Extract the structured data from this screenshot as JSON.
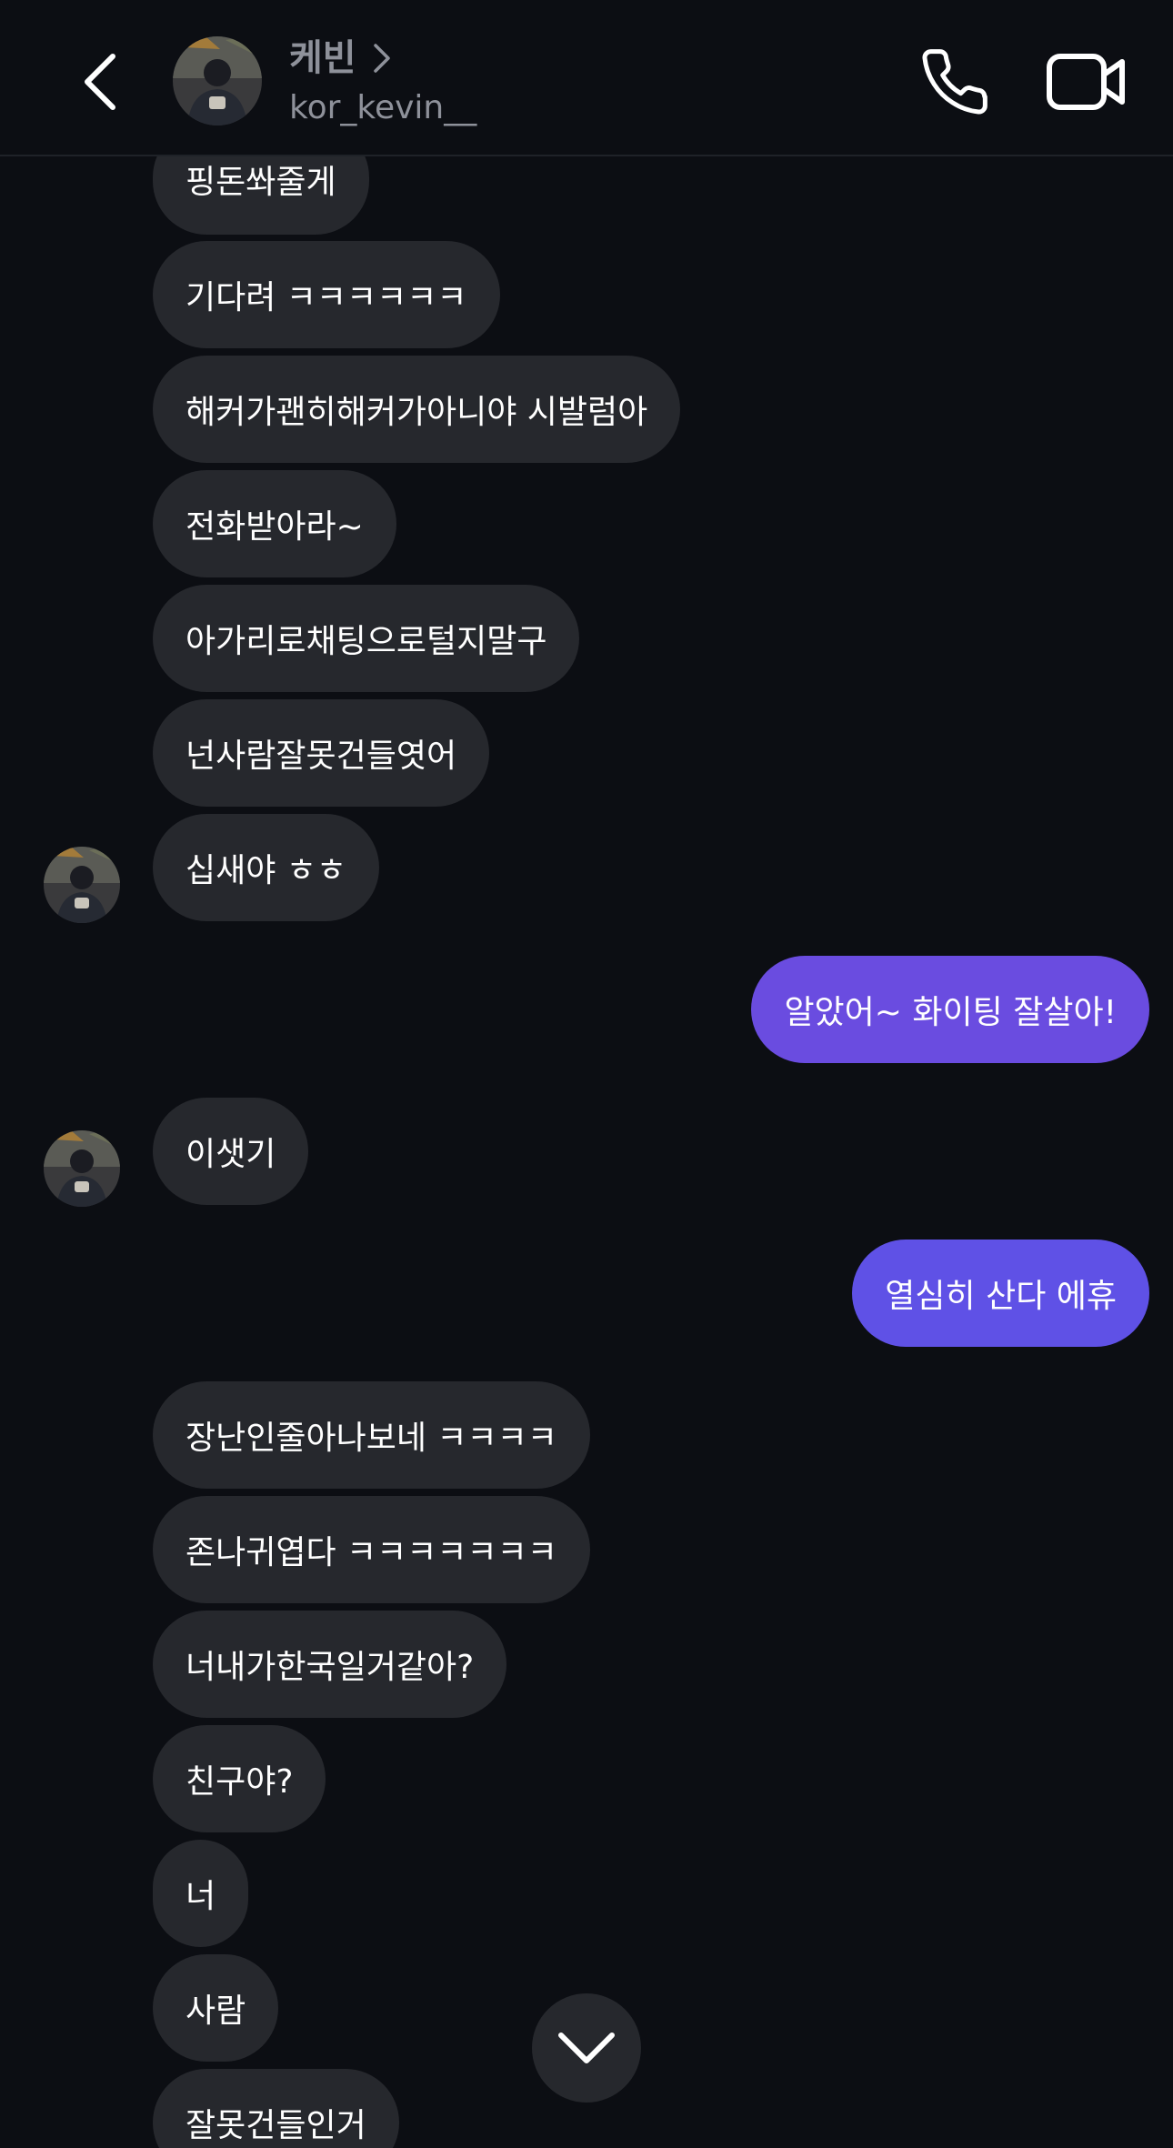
{
  "header": {
    "contact_name": "케빈",
    "username": "kor_kevin__",
    "icons": {
      "back": "chevron-left-icon",
      "name_link": "chevron-right-icon",
      "call": "phone-icon",
      "video": "video-camera-icon"
    }
  },
  "messages": [
    {
      "from": "them",
      "text": "핑돈쏴줄게"
    },
    {
      "from": "them",
      "text": "기다려 ㅋㅋㅋㅋㅋㅋ"
    },
    {
      "from": "them",
      "text": "해커가괜히해커가아니야 시발럼아"
    },
    {
      "from": "them",
      "text": "전화받아라~"
    },
    {
      "from": "them",
      "text": "아가리로채팅으로털지말구"
    },
    {
      "from": "them",
      "text": "넌사람잘못건들엿어"
    },
    {
      "from": "them",
      "text": "십새야 ㅎㅎ"
    },
    {
      "from": "me",
      "text": "알았어~ 화이팅 잘살아!"
    },
    {
      "from": "them",
      "text": "이샛기"
    },
    {
      "from": "me",
      "text": "열심히 산다 에휴"
    },
    {
      "from": "them",
      "text": "장난인줄아나보네 ㅋㅋㅋㅋ"
    },
    {
      "from": "them",
      "text": "존나귀엽다 ㅋㅋㅋㅋㅋㅋㅋ"
    },
    {
      "from": "them",
      "text": "너내가한국일거같아?"
    },
    {
      "from": "them",
      "text": "친구야?"
    },
    {
      "from": "them",
      "text": "너"
    },
    {
      "from": "them",
      "text": "사람"
    },
    {
      "from": "them",
      "text": "잘못건들인거"
    }
  ],
  "colors": {
    "background": "#0c0e13",
    "incoming_bubble": "#26282d",
    "outgoing_bubble": "#6a4ce0",
    "muted_text": "#8e919a"
  },
  "scroll_down_icon": "chevron-down-icon"
}
